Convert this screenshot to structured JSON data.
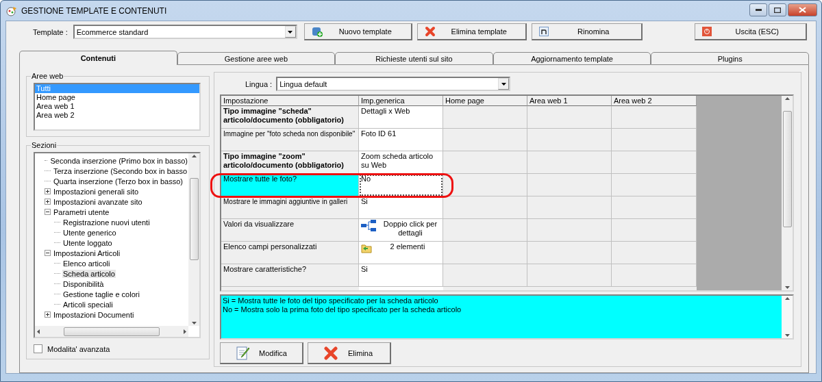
{
  "window": {
    "title": "GESTIONE TEMPLATE E CONTENUTI"
  },
  "toolbar": {
    "template_label": "Template :",
    "template_value": "Ecommerce standard",
    "buttons": [
      {
        "kind": "new",
        "label": "Nuovo template"
      },
      {
        "kind": "delete",
        "label": "Elimina template"
      },
      {
        "kind": "rename",
        "label": "Rinomina"
      },
      {
        "kind": "exit",
        "label": "Uscita (ESC)"
      }
    ]
  },
  "tabs": [
    {
      "label": "Contenuti",
      "selected": true
    },
    {
      "label": "Gestione aree web",
      "selected": false
    },
    {
      "label": "Richieste utenti sul sito",
      "selected": false
    },
    {
      "label": "Aggiornamento template",
      "selected": false
    },
    {
      "label": "Plugins",
      "selected": false
    }
  ],
  "aree_web": {
    "title": "Aree web",
    "items": [
      {
        "label": "Tutti",
        "selected": true
      },
      {
        "label": "Home page",
        "selected": false
      },
      {
        "label": "Area web 1",
        "selected": false
      },
      {
        "label": "Area web 2",
        "selected": false
      }
    ]
  },
  "sezioni": {
    "title": "Sezioni",
    "items": [
      {
        "label": "Seconda inserzione (Primo box in basso)",
        "selected": false
      },
      {
        "label": "Terza inserzione (Secondo box in basso",
        "selected": false
      },
      {
        "label": "Quarta inserzione (Terzo box in basso)",
        "selected": false
      },
      {
        "label": "Impostazioni generali sito",
        "selected": false,
        "expanded": false
      },
      {
        "label": "Impostazioni avanzate sito",
        "selected": false,
        "expanded": false
      },
      {
        "label": "Parametri utente",
        "selected": false,
        "expanded": true,
        "children": [
          {
            "label": "Registrazione nuovi utenti",
            "selected": false
          },
          {
            "label": "Utente generico",
            "selected": false
          },
          {
            "label": "Utente loggato",
            "selected": false
          }
        ]
      },
      {
        "label": "Impostazioni Articoli",
        "selected": false,
        "expanded": true,
        "children": [
          {
            "label": "Elenco articoli",
            "selected": false
          },
          {
            "label": "Scheda articolo",
            "selected": true
          },
          {
            "label": "Disponibilità",
            "selected": false
          },
          {
            "label": "Gestione taglie e colori",
            "selected": false
          },
          {
            "label": "Articoli speciali",
            "selected": false
          }
        ]
      },
      {
        "label": "Impostazioni Documenti",
        "selected": false,
        "expanded": false
      }
    ]
  },
  "advanced_mode": {
    "label": "Modalita' avanzata",
    "checked": false
  },
  "lingua": {
    "label": "Lingua :",
    "value": "Lingua default"
  },
  "table": {
    "columns": [
      "Impostazione",
      "Imp.generica",
      "Home page",
      "Area web 1",
      "Area web 2"
    ],
    "rows": [
      {
        "setting": "Tipo immagine \"scheda\" articolo/documento (obbligatorio)",
        "bold": true,
        "selected": false,
        "value": {
          "kind": "text",
          "text": "Dettagli x Web"
        }
      },
      {
        "setting": "Immagine per \"foto scheda non disponibile\"",
        "bold": false,
        "selected": false,
        "value": {
          "kind": "text",
          "text": "Foto ID 61"
        }
      },
      {
        "setting": "Tipo immagine \"zoom\" articolo/documento (obbligatorio)",
        "bold": true,
        "selected": false,
        "value": {
          "kind": "text",
          "text": "Zoom scheda articolo su Web"
        }
      },
      {
        "setting": "Mostrare tutte le foto?",
        "bold": false,
        "selected": true,
        "value": {
          "kind": "text",
          "text": "No"
        }
      },
      {
        "setting": "Mostrare le immagini aggiuntive in galleri",
        "bold": false,
        "selected": false,
        "value": {
          "kind": "text",
          "text": "Si"
        }
      },
      {
        "setting": "Valori da visualizzare",
        "bold": false,
        "selected": false,
        "value": {
          "kind": "hierarchy",
          "text": "Doppio click per dettagli"
        }
      },
      {
        "setting": "Elenco campi personalizzati",
        "bold": false,
        "selected": false,
        "value": {
          "kind": "folder",
          "text": "2 elementi"
        }
      },
      {
        "setting": "Mostrare caratteristiche?",
        "bold": false,
        "selected": false,
        "value": {
          "kind": "text",
          "text": "Si"
        }
      }
    ]
  },
  "description": "Si = Mostra tutte le foto del tipo specificato per la scheda articolo\nNo = Mostra solo la prima foto del tipo specificato per la scheda articolo",
  "actions": [
    {
      "kind": "edit",
      "label": "Modifica"
    },
    {
      "kind": "delete",
      "label": "Elimina"
    }
  ]
}
